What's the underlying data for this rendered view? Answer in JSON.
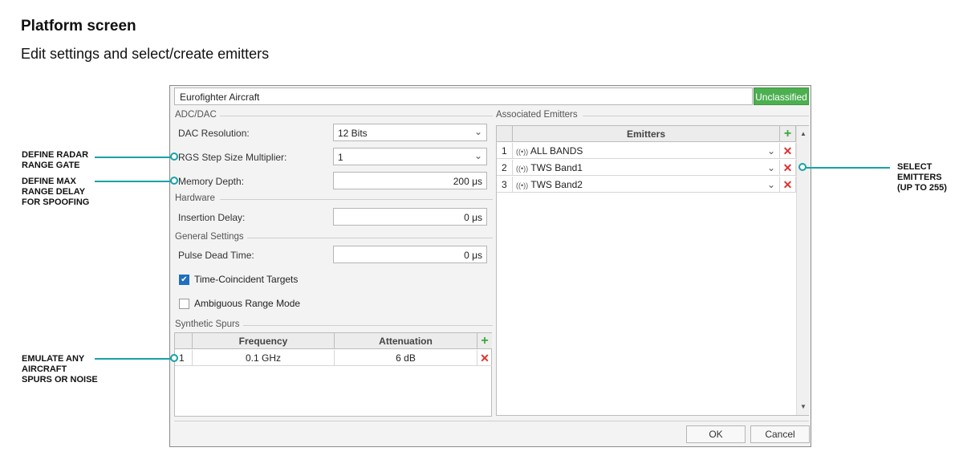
{
  "page": {
    "title": "Platform screen",
    "subtitle": "Edit settings and select/create emitters"
  },
  "dialog": {
    "platform_name": "Eurofighter Aircraft",
    "classification": "Unclassified",
    "classification_color": "#4caf50",
    "adc_dac_group": "ADC/DAC",
    "dac_resolution_label": "DAC Resolution:",
    "dac_resolution_value": "12 Bits",
    "rgs_label": "RGS Step Size Multiplier:",
    "rgs_value": "1",
    "memory_depth_label": "Memory Depth:",
    "memory_depth_value": "200 μs",
    "hardware_group": "Hardware",
    "insertion_delay_label": "Insertion Delay:",
    "insertion_delay_value": "0 μs",
    "general_group": "General Settings",
    "pulse_dead_time_label": "Pulse Dead Time:",
    "pulse_dead_time_value": "0 μs",
    "time_coincident_label": "Time-Coincident Targets",
    "time_coincident_checked": true,
    "ambiguous_label": "Ambiguous Range Mode",
    "ambiguous_checked": false,
    "spurs_group": "Synthetic Spurs",
    "spurs_headers": {
      "frequency": "Frequency",
      "attenuation": "Attenuation"
    },
    "spurs_rows": [
      {
        "index": "1",
        "frequency": "0.1 GHz",
        "attenuation": "6 dB"
      }
    ],
    "emitters_group": "Associated Emitters",
    "emitters_header": "Emitters",
    "emitters_rows": [
      {
        "index": "1",
        "name": "ALL BANDS"
      },
      {
        "index": "2",
        "name": "TWS Band1"
      },
      {
        "index": "3",
        "name": "TWS Band2"
      }
    ],
    "ok_label": "OK",
    "cancel_label": "Cancel"
  },
  "annotations": {
    "radar_gate_line1": "DEFINE RADAR",
    "radar_gate_line2": "RANGE GATE",
    "max_range_line1": "DEFINE MAX",
    "max_range_line2": "RANGE DELAY",
    "max_range_line3": "FOR SPOOFING",
    "spurs_line1": "EMULATE ANY",
    "spurs_line2": "AIRCRAFT",
    "spurs_line3": "SPURS OR NOISE",
    "emitters_line1": "SELECT",
    "emitters_line2": "EMITTERS",
    "emitters_line3": "(UP TO 255)",
    "accent_color": "#17a2a6"
  }
}
